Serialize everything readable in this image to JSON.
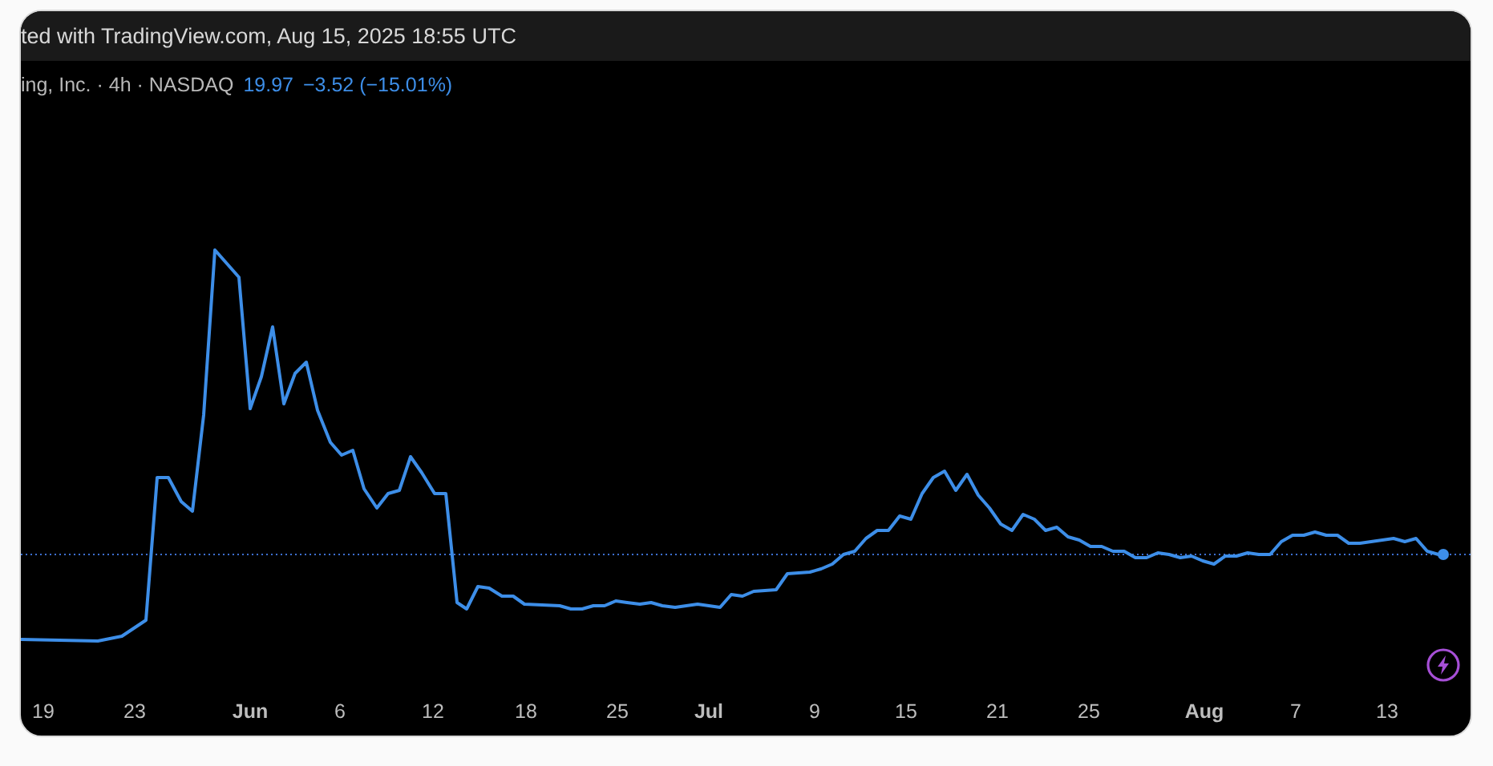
{
  "header": {
    "caption": "ted with TradingView.com, Aug 15, 2025 18:55 UTC"
  },
  "legend": {
    "symbol": "ing, Inc. · 4h · NASDAQ",
    "price": "19.97",
    "change": "−3.52 (−15.01%)"
  },
  "x_axis": [
    {
      "label": "19",
      "kind": "day"
    },
    {
      "label": "23",
      "kind": "day"
    },
    {
      "label": "Jun",
      "kind": "month"
    },
    {
      "label": "6",
      "kind": "day"
    },
    {
      "label": "12",
      "kind": "day"
    },
    {
      "label": "18",
      "kind": "day"
    },
    {
      "label": "25",
      "kind": "day"
    },
    {
      "label": "Jul",
      "kind": "month"
    },
    {
      "label": "9",
      "kind": "day"
    },
    {
      "label": "15",
      "kind": "day"
    },
    {
      "label": "21",
      "kind": "day"
    },
    {
      "label": "25",
      "kind": "day"
    },
    {
      "label": "Aug",
      "kind": "month"
    },
    {
      "label": "7",
      "kind": "day"
    },
    {
      "label": "13",
      "kind": "day"
    }
  ]
}
